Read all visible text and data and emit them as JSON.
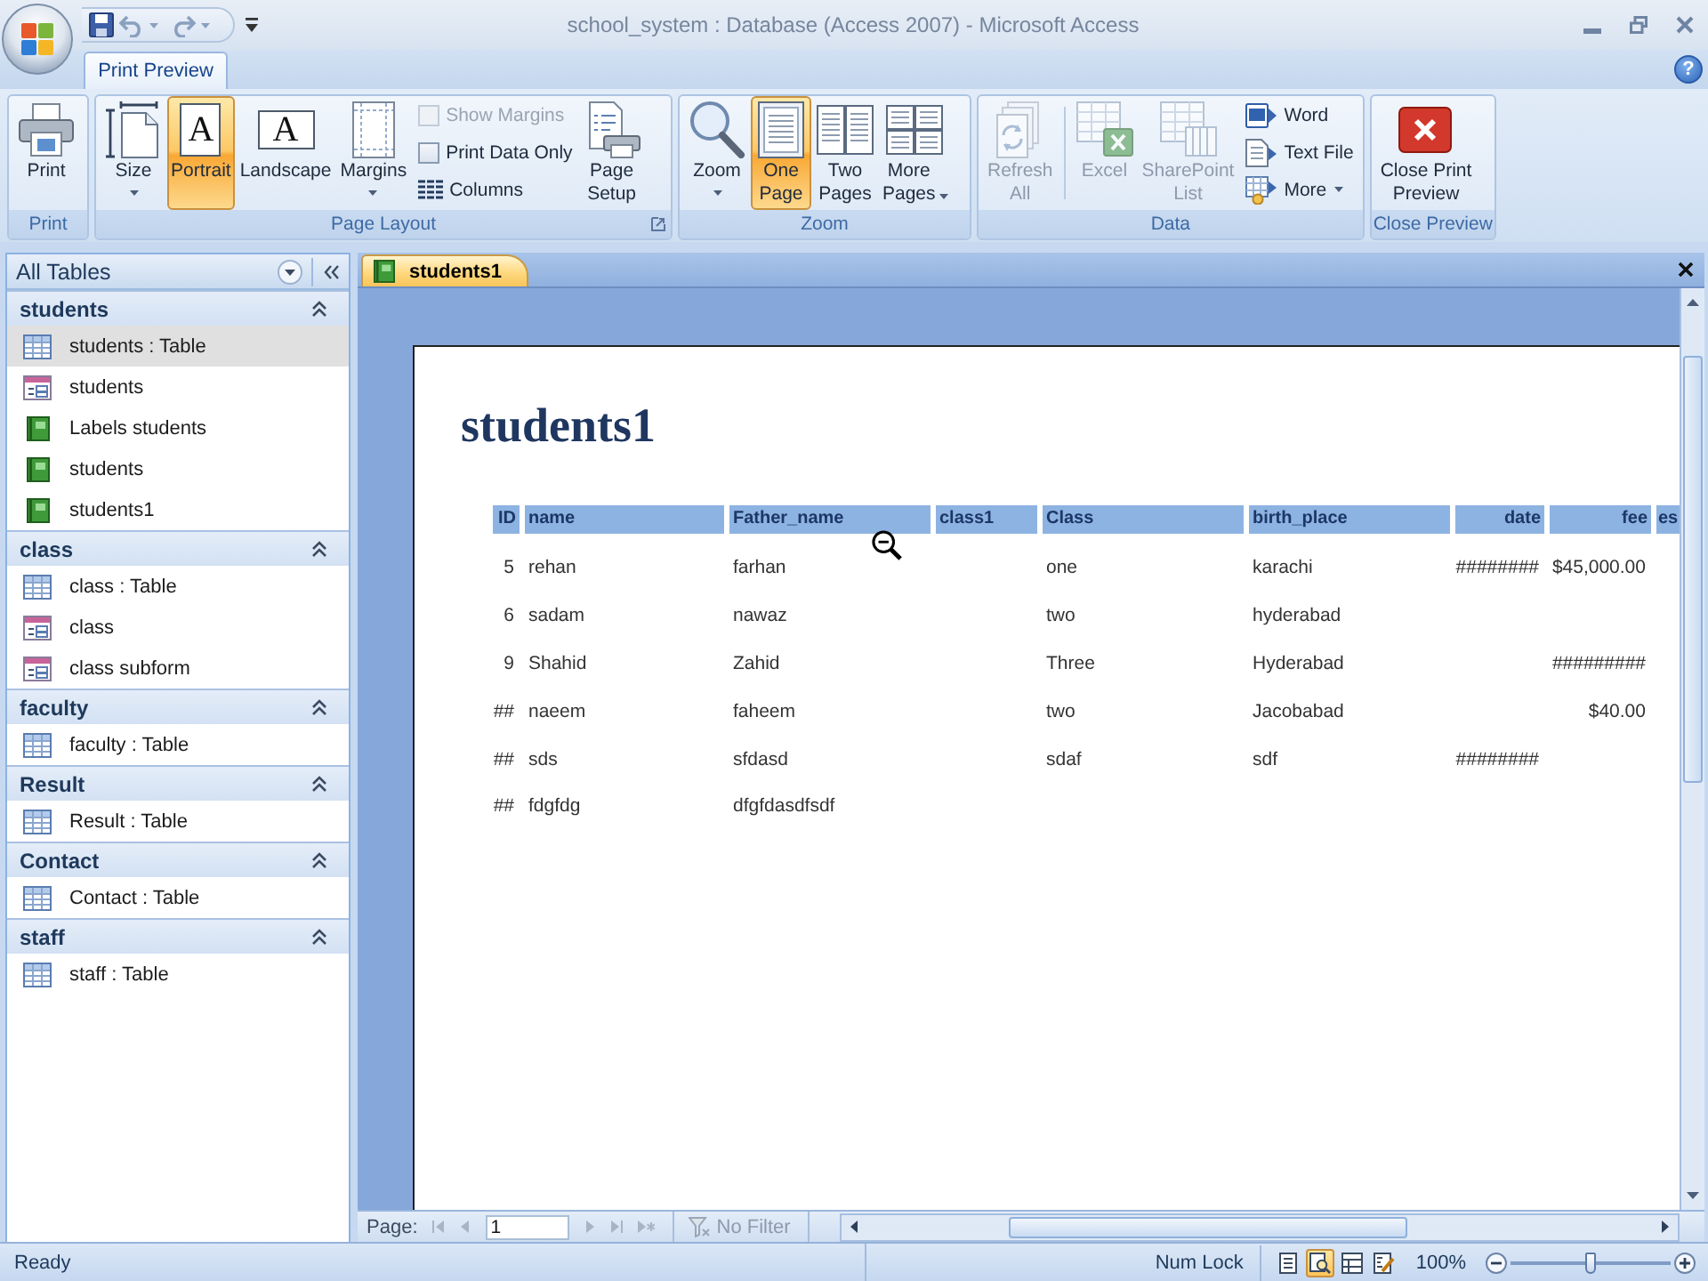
{
  "window": {
    "title": "school_system : Database (Access 2007) - Microsoft Access"
  },
  "help": {
    "glyph": "?"
  },
  "ribbon_tabs": [
    {
      "label": "Print Preview",
      "selected": true
    }
  ],
  "ribbon_groups": [
    {
      "label": "Print",
      "launcher": false,
      "controls": [
        {
          "kind": "large",
          "label": [
            "Print"
          ],
          "selected": false,
          "disabled": false,
          "dropdown": false
        }
      ]
    },
    {
      "label": "Page Layout",
      "launcher": true,
      "controls": [
        {
          "kind": "large",
          "label": [
            "Size"
          ],
          "selected": false,
          "disabled": false,
          "dropdown": true
        },
        {
          "kind": "large",
          "label": [
            "Portrait"
          ],
          "glyph": "A",
          "selected": true,
          "disabled": false,
          "dropdown": false
        },
        {
          "kind": "large",
          "label": [
            "Landscape"
          ],
          "glyph": "A",
          "selected": false,
          "disabled": false,
          "dropdown": false
        },
        {
          "kind": "large",
          "label": [
            "Margins"
          ],
          "selected": false,
          "disabled": false,
          "dropdown": true
        },
        {
          "kind": "stack",
          "items": [
            {
              "kind": "checkbox",
              "label": "Show Margins",
              "checked": false,
              "disabled": true
            },
            {
              "kind": "checkbox",
              "label": "Print Data Only",
              "checked": false,
              "disabled": false
            },
            {
              "kind": "command",
              "label": "Columns",
              "disabled": false,
              "dropdown": false
            }
          ]
        },
        {
          "kind": "large",
          "label": [
            "Page",
            "Setup"
          ],
          "selected": false,
          "disabled": false,
          "dropdown": false
        }
      ]
    },
    {
      "label": "Zoom",
      "launcher": false,
      "controls": [
        {
          "kind": "large",
          "label": [
            "Zoom"
          ],
          "selected": false,
          "disabled": false,
          "dropdown": true
        },
        {
          "kind": "large",
          "label": [
            "One",
            "Page"
          ],
          "selected": true,
          "disabled": false,
          "dropdown": false
        },
        {
          "kind": "large",
          "label": [
            "Two",
            "Pages"
          ],
          "selected": false,
          "disabled": false,
          "dropdown": false
        },
        {
          "kind": "large",
          "label": [
            "More",
            "Pages"
          ],
          "selected": false,
          "disabled": false,
          "dropdown": true
        }
      ]
    },
    {
      "label": "Data",
      "launcher": false,
      "controls": [
        {
          "kind": "large",
          "label": [
            "Refresh",
            "All"
          ],
          "selected": false,
          "disabled": true,
          "dropdown": false
        },
        {
          "kind": "large",
          "label": [
            "Excel"
          ],
          "selected": false,
          "disabled": true,
          "dropdown": false
        },
        {
          "kind": "large",
          "label": [
            "SharePoint",
            "List"
          ],
          "selected": false,
          "disabled": true,
          "dropdown": false
        },
        {
          "kind": "stack",
          "items": [
            {
              "kind": "command",
              "label": "Word",
              "disabled": false,
              "dropdown": false
            },
            {
              "kind": "command",
              "label": "Text File",
              "disabled": false,
              "dropdown": false
            },
            {
              "kind": "command",
              "label": "More",
              "disabled": false,
              "dropdown": true
            }
          ]
        }
      ]
    },
    {
      "label": "Close Preview",
      "launcher": false,
      "controls": [
        {
          "kind": "large",
          "label": [
            "Close Print",
            "Preview"
          ],
          "selected": false,
          "disabled": false,
          "dropdown": false
        }
      ]
    }
  ],
  "nav_pane": {
    "title": "All Tables",
    "groups": [
      {
        "label": "students",
        "expanded": true,
        "items": [
          {
            "kind": "table",
            "label": "students : Table",
            "selected": true
          },
          {
            "kind": "form",
            "label": "students",
            "selected": false
          },
          {
            "kind": "report",
            "label": "Labels students",
            "selected": false
          },
          {
            "kind": "report",
            "label": "students",
            "selected": false
          },
          {
            "kind": "report",
            "label": "students1",
            "selected": false
          }
        ]
      },
      {
        "label": "class",
        "expanded": true,
        "items": [
          {
            "kind": "table",
            "label": "class : Table",
            "selected": false
          },
          {
            "kind": "form",
            "label": "class",
            "selected": false
          },
          {
            "kind": "form",
            "label": "class subform",
            "selected": false
          }
        ]
      },
      {
        "label": "faculty",
        "expanded": true,
        "items": [
          {
            "kind": "table",
            "label": "faculty : Table",
            "selected": false
          }
        ]
      },
      {
        "label": "Result",
        "expanded": true,
        "items": [
          {
            "kind": "table",
            "label": "Result : Table",
            "selected": false
          }
        ]
      },
      {
        "label": "Contact",
        "expanded": true,
        "items": [
          {
            "kind": "table",
            "label": "Contact : Table",
            "selected": false
          }
        ]
      },
      {
        "label": "staff",
        "expanded": true,
        "items": [
          {
            "kind": "table",
            "label": "staff : Table",
            "selected": false
          }
        ]
      }
    ]
  },
  "document_tabs": [
    {
      "label": "students1",
      "selected": true
    }
  ],
  "report": {
    "title": "students1",
    "columns": [
      "ID",
      "name",
      "Father_name",
      "class1",
      "Class",
      "birth_place",
      "date",
      "fee",
      "es"
    ],
    "rows": [
      [
        "5",
        "rehan",
        "farhan",
        null,
        "one",
        "karachi",
        "########",
        "$45,000.00",
        null
      ],
      [
        "6",
        "sadam",
        "nawaz",
        null,
        "two",
        "hyderabad",
        null,
        null,
        null
      ],
      [
        "9",
        "Shahid",
        "Zahid",
        null,
        "Three",
        "Hyderabad",
        null,
        "#########",
        null
      ],
      [
        "##",
        "naeem",
        "faheem",
        null,
        "two",
        "Jacobabad",
        null,
        "$40.00",
        null
      ],
      [
        "##",
        "sds",
        "sfdasd",
        null,
        "sdaf",
        "sdf",
        "########",
        null,
        null
      ],
      [
        "##",
        "fdgfdg",
        "dfgfdasdfsdf",
        null,
        null,
        null,
        null,
        null,
        null
      ]
    ]
  },
  "record_navigator": {
    "label": "Page:",
    "value": "1",
    "filter": "No Filter"
  },
  "status_bar": {
    "text": "Ready",
    "indicators": [
      "Num Lock"
    ],
    "views": [
      {
        "selected": false
      },
      {
        "selected": true
      },
      {
        "selected": false
      },
      {
        "selected": false
      }
    ],
    "zoom": "100%",
    "zoom_slider": {
      "level": 0.5
    }
  }
}
